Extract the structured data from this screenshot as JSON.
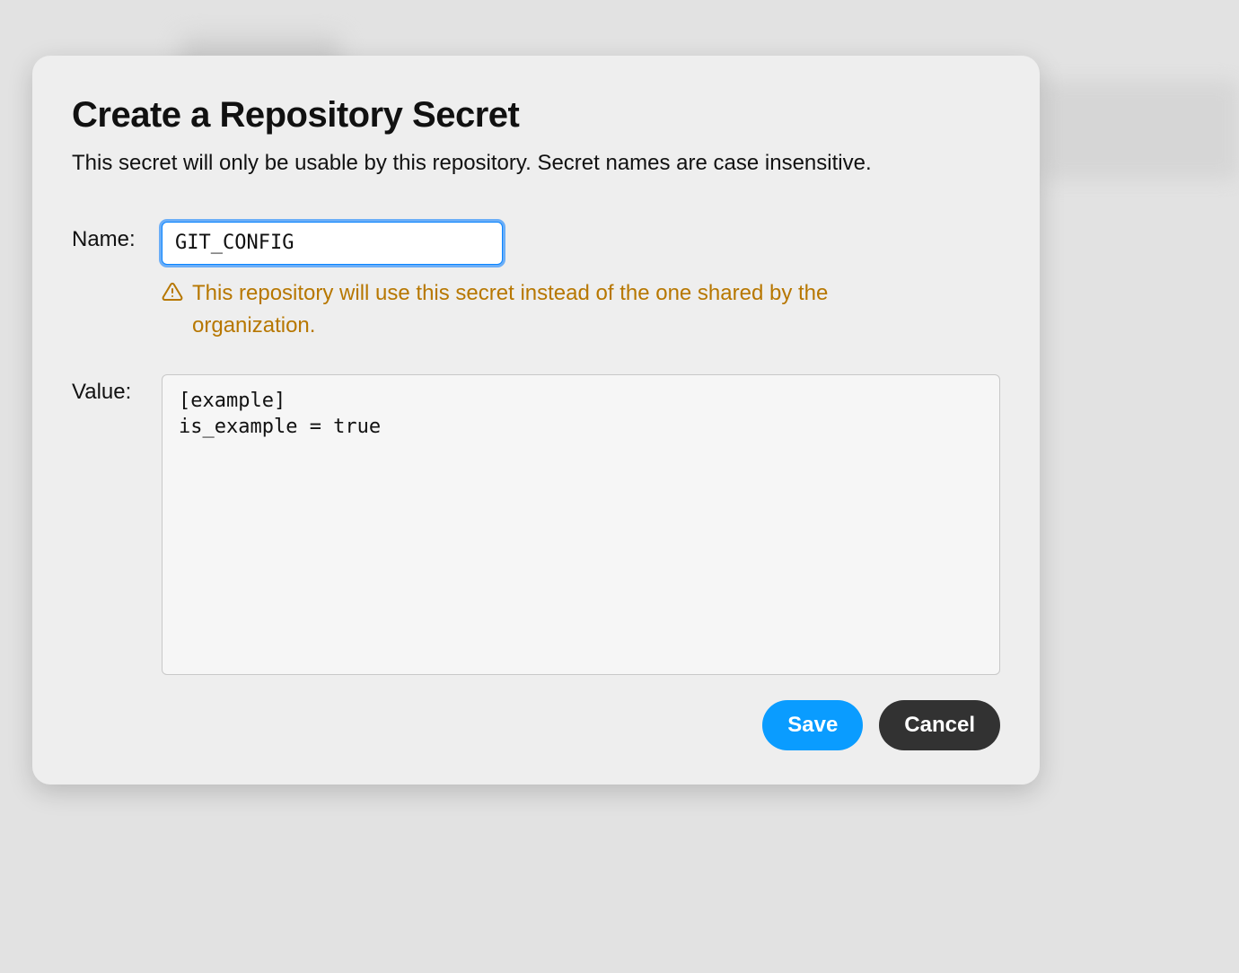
{
  "modal": {
    "title": "Create a Repository Secret",
    "subtitle": "This secret will only be usable by this repository. Secret names are case insensitive.",
    "name_label": "Name:",
    "name_value": "GIT_CONFIG",
    "warning_text": "This repository will use this secret instead of the one shared by the organization.",
    "value_label": "Value:",
    "value_content": "[example]\nis_example = true",
    "save_label": "Save",
    "cancel_label": "Cancel"
  }
}
